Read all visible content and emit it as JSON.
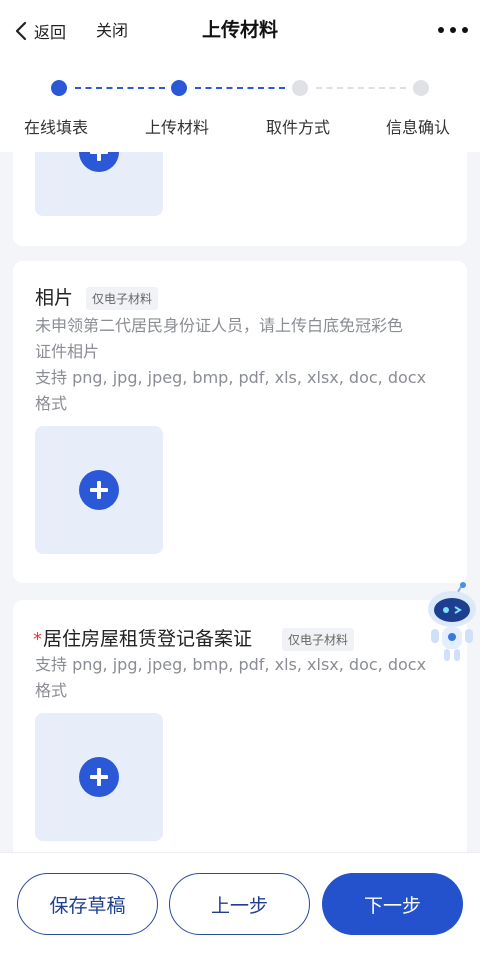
{
  "nav": {
    "back_label": "返回",
    "close_label": "关闭",
    "title": "上传材料"
  },
  "steps": [
    {
      "label": "在线填表",
      "state": "done"
    },
    {
      "label": "上传材料",
      "state": "current"
    },
    {
      "label": "取件方式",
      "state": "pending"
    },
    {
      "label": "信息确认",
      "state": "pending"
    }
  ],
  "sections": [
    {
      "title": "",
      "required": false,
      "tag": "",
      "description": []
    },
    {
      "title": "相片",
      "required": false,
      "tag": "仅电子材料",
      "description": [
        "未申领第二代居民身份证人员，请上传白底免冠彩色",
        "证件相片",
        "支持 png, jpg, jpeg, bmp, pdf, xls, xlsx, doc, docx",
        "格式"
      ]
    },
    {
      "title": "居住房屋租赁登记备案证",
      "required": true,
      "required_mark": "*",
      "tag": "仅电子材料",
      "description": [
        "支持 png, jpg, jpeg, bmp, pdf, xls, xlsx, doc, docx",
        "格式"
      ]
    }
  ],
  "footer": {
    "save_draft_label": "保存草稿",
    "prev_label": "上一步",
    "next_label": "下一步"
  },
  "icons": {
    "back": "chevron-left-icon",
    "more": "more-dots-icon",
    "upload": "plus-icon",
    "assistant": "robot-assistant-icon"
  },
  "colors": {
    "accent": "#2452cc",
    "step_active": "#2a58d6",
    "step_inactive": "#dfe1e6",
    "upload_bg": "#e8eef9",
    "required": "#e53935"
  }
}
